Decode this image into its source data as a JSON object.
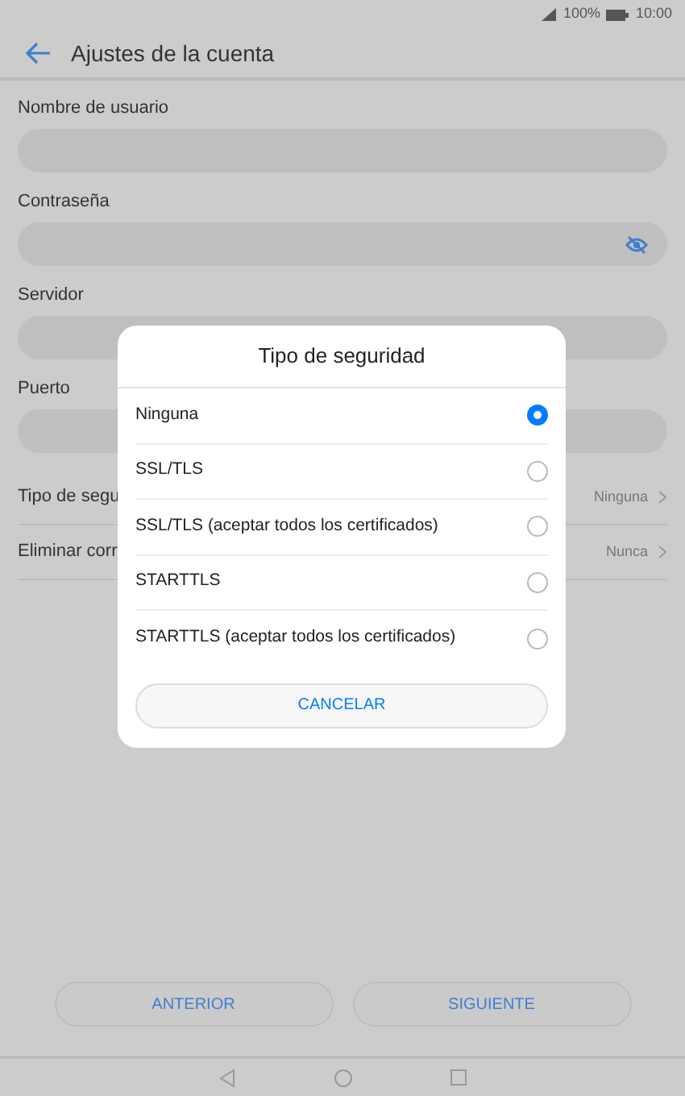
{
  "status_bar": {
    "battery": "100%",
    "time": "10:00"
  },
  "header": {
    "title": "Ajustes de la cuenta"
  },
  "form": {
    "fields": [
      {
        "label": "Nombre de usuario",
        "kind": "text"
      },
      {
        "label": "Contraseña",
        "kind": "password"
      },
      {
        "label": "Servidor",
        "kind": "text"
      },
      {
        "label": "Puerto",
        "kind": "text"
      }
    ],
    "settings": [
      {
        "label": "Tipo de segu",
        "value": "Ninguna"
      },
      {
        "label": "Eliminar corr",
        "value": "Nunca"
      }
    ]
  },
  "dialog": {
    "title": "Tipo de seguridad",
    "options": [
      {
        "label": "Ninguna",
        "selected": true
      },
      {
        "label": "SSL/TLS",
        "selected": false
      },
      {
        "label": "SSL/TLS (aceptar todos los certificados)",
        "selected": false
      },
      {
        "label": "STARTTLS",
        "selected": false
      },
      {
        "label": "STARTTLS (aceptar todos los certificados)",
        "selected": false
      }
    ],
    "cancel": "CANCELAR"
  },
  "buttons": [
    "ANTERIOR",
    "SIGUIENTE"
  ]
}
